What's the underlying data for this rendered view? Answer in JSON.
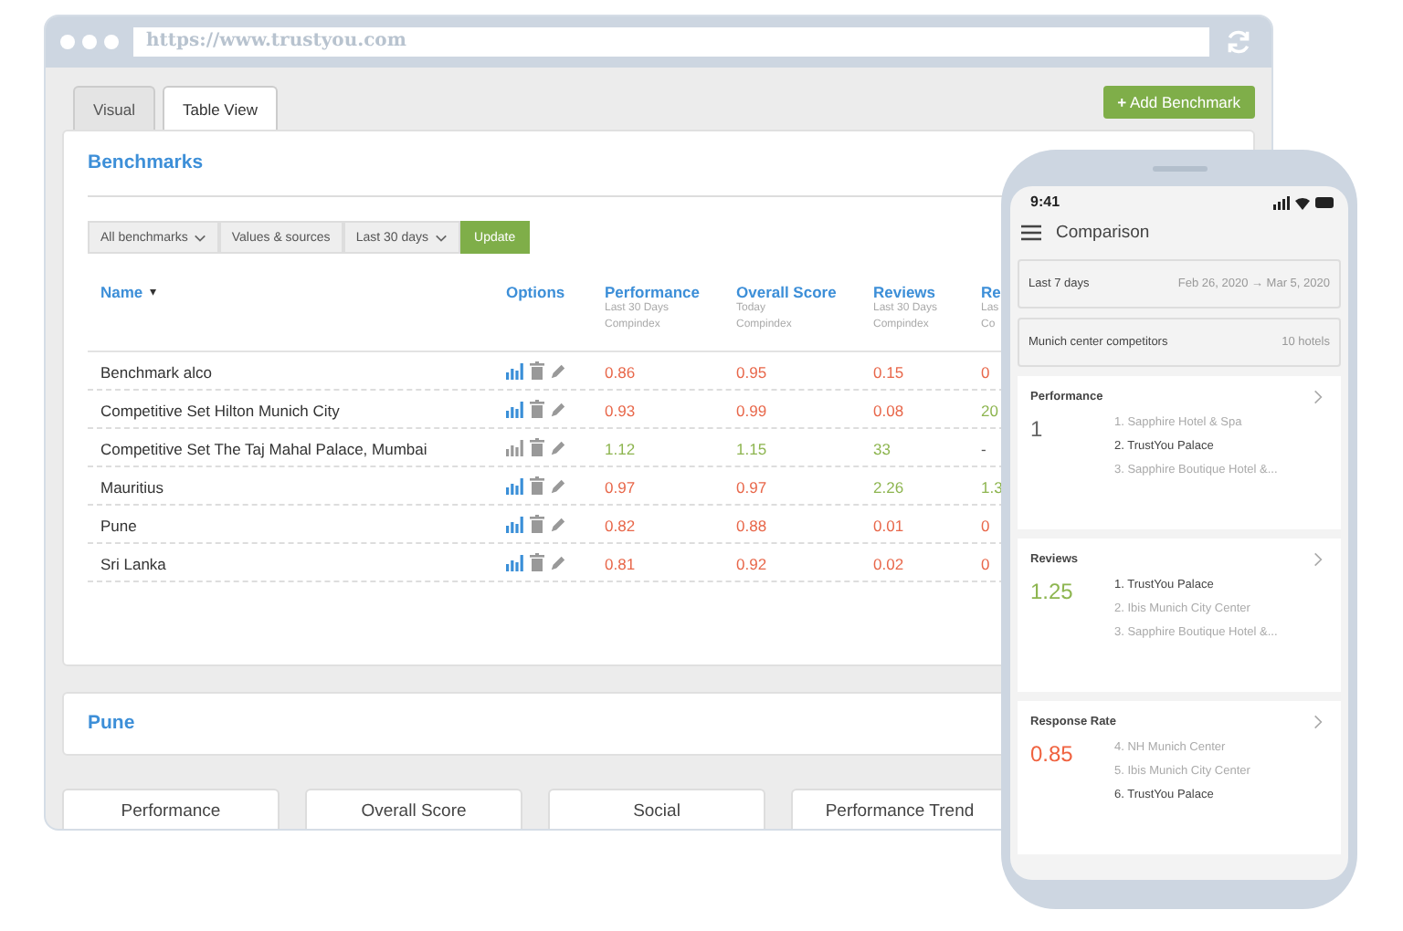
{
  "browser": {
    "url": "https://www.trustyou.com"
  },
  "tabs": [
    {
      "label": "Visual",
      "selected": false
    },
    {
      "label": "Table View",
      "selected": true
    }
  ],
  "add_button": {
    "icon": "+",
    "label": "Add Benchmark"
  },
  "benchmarks": {
    "title": "Benchmarks",
    "filters": [
      "All benchmarks",
      "Values & sources",
      "Last 30 days"
    ],
    "update_button": "Update",
    "columns": [
      {
        "label": "Name",
        "sort": "▾"
      },
      {
        "label": "Options"
      },
      {
        "label": "Performance",
        "sub": [
          "Last 30 Days",
          "Compindex"
        ]
      },
      {
        "label": "Overall Score",
        "sub": [
          "Today",
          "Compindex"
        ]
      },
      {
        "label": "Reviews",
        "sub": [
          "Last 30 Days",
          "Compindex"
        ]
      },
      {
        "label": "Re",
        "sub": [
          "Las",
          "Co"
        ]
      }
    ],
    "rows": [
      {
        "name": "Benchmark alco",
        "chart_active": true,
        "values": [
          {
            "text": "0.86",
            "color": "#e8674a"
          },
          {
            "text": "0.95",
            "color": "#e8674a"
          },
          {
            "text": "0.15",
            "color": "#e8674a"
          },
          {
            "text": "0",
            "color": "#e8674a"
          }
        ]
      },
      {
        "name": "Competitive Set Hilton Munich City",
        "chart_active": true,
        "values": [
          {
            "text": "0.93",
            "color": "#e8674a"
          },
          {
            "text": "0.99",
            "color": "#e8674a"
          },
          {
            "text": "0.08",
            "color": "#e8674a"
          },
          {
            "text": "20",
            "color": "#8db54f"
          }
        ]
      },
      {
        "name": "Competitive Set The Taj Mahal Palace, Mumbai",
        "chart_active": false,
        "values": [
          {
            "text": "1.12",
            "color": "#8db54f"
          },
          {
            "text": "1.15",
            "color": "#8db54f"
          },
          {
            "text": "33",
            "color": "#8db54f"
          },
          {
            "text": "-",
            "color": "#555555"
          }
        ]
      },
      {
        "name": "Mauritius",
        "chart_active": true,
        "values": [
          {
            "text": "0.97",
            "color": "#e8674a"
          },
          {
            "text": "0.97",
            "color": "#e8674a"
          },
          {
            "text": "2.26",
            "color": "#8db54f"
          },
          {
            "text": "1.3",
            "color": "#8db54f"
          }
        ]
      },
      {
        "name": "Pune",
        "chart_active": true,
        "values": [
          {
            "text": "0.82",
            "color": "#e8674a"
          },
          {
            "text": "0.88",
            "color": "#e8674a"
          },
          {
            "text": "0.01",
            "color": "#e8674a"
          },
          {
            "text": "0",
            "color": "#e8674a"
          }
        ]
      },
      {
        "name": "Sri Lanka",
        "chart_active": true,
        "values": [
          {
            "text": "0.81",
            "color": "#e8674a"
          },
          {
            "text": "0.92",
            "color": "#e8674a"
          },
          {
            "text": "0.02",
            "color": "#e8674a"
          },
          {
            "text": "0",
            "color": "#e8674a"
          }
        ]
      }
    ]
  },
  "section": {
    "title": "Pune"
  },
  "bottom_tabs": [
    "Performance",
    "Overall Score",
    "Social",
    "Performance Trend"
  ],
  "phone": {
    "time": "9:41",
    "title": "Comparison",
    "period": {
      "label": "Last 7 days",
      "range": "Feb 26, 2020 → Mar 5, 2020"
    },
    "group": {
      "label": "Munich center competitors",
      "count": "10 hotels"
    },
    "cards": [
      {
        "title": "Performance",
        "score": "1",
        "color": "#666666",
        "items": [
          {
            "text": "1. Sapphire Hotel & Spa",
            "current": false
          },
          {
            "text": "2. TrustYou Palace",
            "current": true
          },
          {
            "text": "3. Sapphire Boutique Hotel &...",
            "current": false
          }
        ]
      },
      {
        "title": "Reviews",
        "score": "1.25",
        "color": "#8db54f",
        "items": [
          {
            "text": "1. TrustYou Palace",
            "current": true
          },
          {
            "text": "2. Ibis Munich City Center",
            "current": false
          },
          {
            "text": "3. Sapphire Boutique Hotel &...",
            "current": false
          }
        ]
      },
      {
        "title": "Response Rate",
        "score": "0.85",
        "color": "#f0623f",
        "items": [
          {
            "text": "4. NH Munich Center",
            "current": false
          },
          {
            "text": "5. Ibis Munich City Center",
            "current": false
          },
          {
            "text": "6. TrustYou Palace",
            "current": true
          }
        ]
      }
    ]
  }
}
